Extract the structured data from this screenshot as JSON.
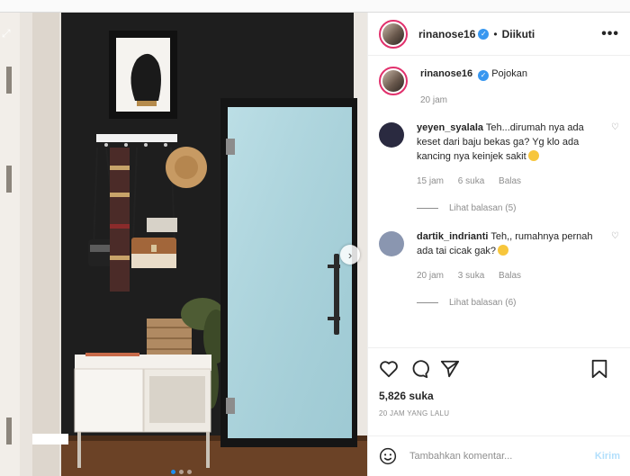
{
  "post": {
    "username": "rinanose16",
    "separator": "•",
    "follow_label": "Diikuti",
    "more_label": "•••",
    "caption": {
      "username": "rinanose16",
      "text": "Pojokan",
      "time": "20 jam"
    },
    "comments": [
      {
        "username": "yeyen_syalala",
        "text": "Teh...dirumah nya ada keset dari baju bekas ga? Yg klo ada kancing nya keinjek sakit",
        "time": "15 jam",
        "likes": "6 suka",
        "reply_label": "Balas",
        "view_replies": "Lihat balasan (5)",
        "avatar_color": "#2a2a40"
      },
      {
        "username": "dartik_indrianti",
        "text": "Teh,, rumahnya pernah ada tai cicak gak?",
        "time": "20 jam",
        "likes": "3 suka",
        "reply_label": "Balas",
        "view_replies": "Lihat balasan (6)",
        "avatar_color": "#8a96b0"
      }
    ],
    "likes_count": "5,826 suka",
    "time_ago": "20 JAM YANG LALU",
    "comment_placeholder": "Tambahkan komentar...",
    "post_button": "Kirim"
  },
  "carousel": {
    "slides": 3,
    "active": 0
  },
  "colors": {
    "accent": "#3897f0",
    "ring": "#e1306c",
    "wall": "#1f1f1f",
    "door": "#a9d3dc"
  },
  "icons": [
    "heart-icon",
    "comment-icon",
    "share-icon",
    "bookmark-icon",
    "emoji-icon",
    "chevron-right-icon",
    "verified-icon"
  ]
}
